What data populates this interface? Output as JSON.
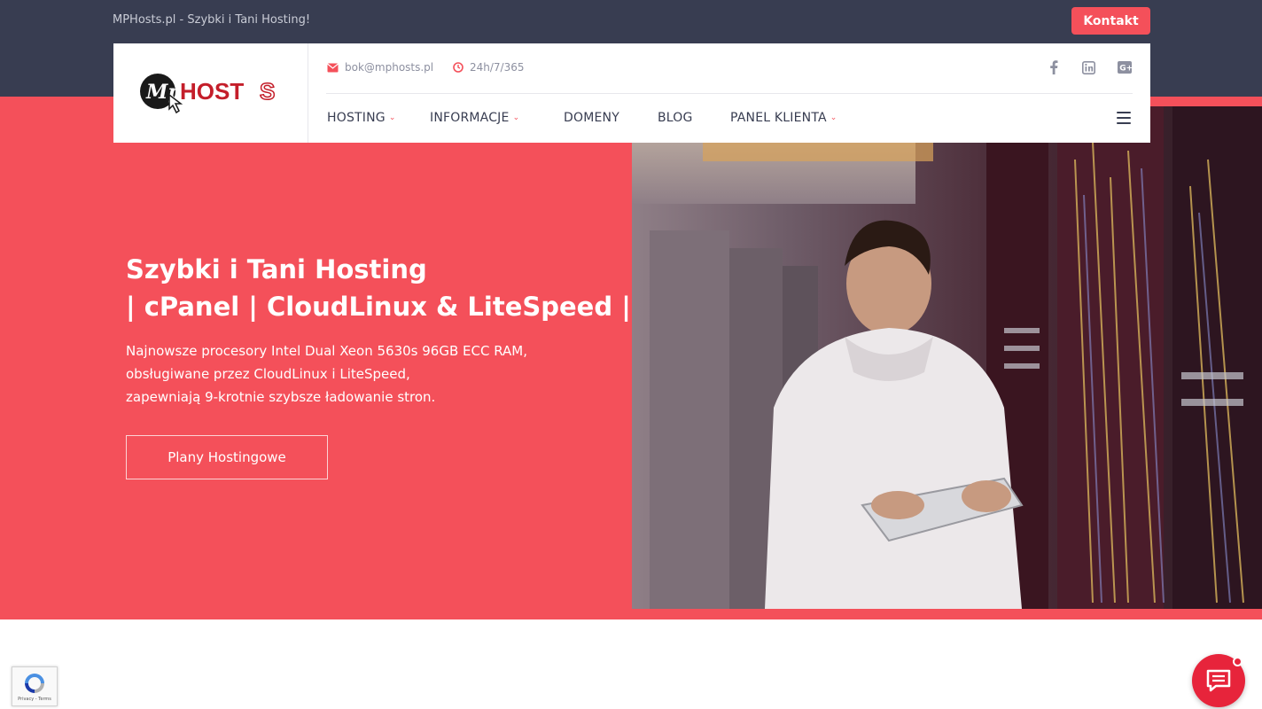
{
  "topbar": {
    "tagline": "MPHosts.pl - Szybki i Tani Hosting!",
    "contact_label": "Kontakt"
  },
  "header": {
    "logo": {
      "text_mp": "Mp",
      "text_host": "HOST",
      "text_s": "S",
      "icon": "mphosts-logo"
    },
    "email": "bok@mphosts.pl",
    "hours": "24h/7/365",
    "social": [
      "facebook-icon",
      "linkedin-icon",
      "google-plus-icon"
    ]
  },
  "nav": {
    "items": [
      {
        "label": "HOSTING",
        "dropdown": true
      },
      {
        "label": "INFORMACJE",
        "dropdown": true
      },
      {
        "label": "DOMENY",
        "dropdown": false
      },
      {
        "label": "BLOG",
        "dropdown": false
      },
      {
        "label": "PANEL KLIENTA",
        "dropdown": true
      }
    ],
    "menu_icon": "hamburger-icon"
  },
  "hero": {
    "title_line1": "Szybki i Tani Hosting",
    "title_line2": "| cPanel | CloudLinux & LiteSpeed |",
    "desc_line1": "Najnowsze procesory Intel Dual Xeon 5630s 96GB ECC RAM,",
    "desc_line2": "obsługiwane przez CloudLinux i LiteSpeed,",
    "desc_line3": "zapewniają 9-krotnie szybsze ładowanie stron.",
    "button_label": "Plany Hostingowe"
  },
  "colors": {
    "accent": "#f4505a",
    "dark": "#383d51",
    "chat": "#e7243b"
  }
}
